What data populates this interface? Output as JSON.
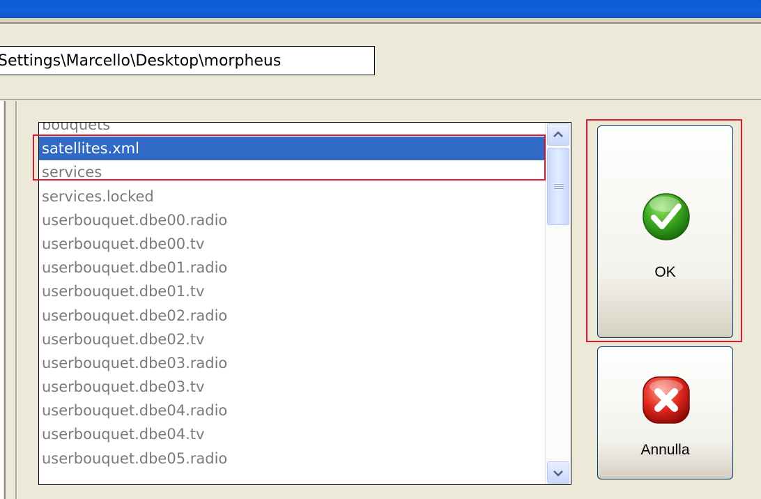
{
  "path_field": {
    "value": "Settings\\Marcello\\Desktop\\morpheus"
  },
  "file_list": {
    "items": [
      "bouquets",
      "satellites.xml",
      "services",
      "services.locked",
      "userbouquet.dbe00.radio",
      "userbouquet.dbe00.tv",
      "userbouquet.dbe01.radio",
      "userbouquet.dbe01.tv",
      "userbouquet.dbe02.radio",
      "userbouquet.dbe02.tv",
      "userbouquet.dbe03.radio",
      "userbouquet.dbe03.tv",
      "userbouquet.dbe04.radio",
      "userbouquet.dbe04.tv",
      "userbouquet.dbe05.radio"
    ],
    "selected": "satellites.xml"
  },
  "buttons": {
    "ok_label": "OK",
    "cancel_label": "Annulla"
  },
  "icons": {
    "ok": "check-icon",
    "cancel": "close-icon"
  },
  "colors": {
    "selection": "#316ac5",
    "highlight_box": "#e0182b",
    "titlebar": "#0a5bd6"
  }
}
